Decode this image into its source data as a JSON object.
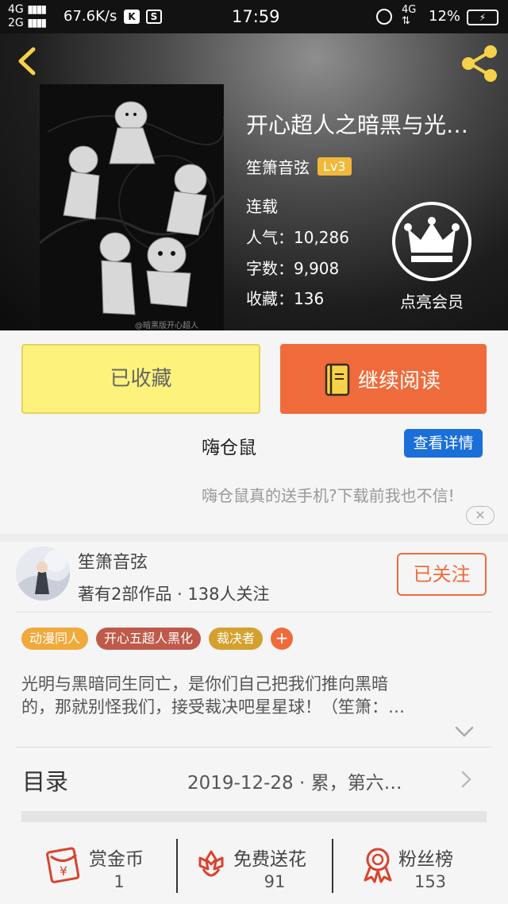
{
  "status_bar": {
    "network_primary": "4G",
    "network_secondary": "2G",
    "speed": "67.6K/s",
    "icon_k": "K",
    "icon_s": "S",
    "time": "17:59",
    "mobile_network": "4G",
    "battery_percent": "12%"
  },
  "header": {
    "book_title": "开心超人之暗黑与光…",
    "author": "笙箫音弦",
    "level_badge": "Lv3",
    "status": "连载",
    "popularity_label": "人气：",
    "popularity": "10,286",
    "word_count_label": "字数：",
    "word_count": "9,908",
    "favorites_label": "收藏：",
    "favorites": "136",
    "vip_label": "点亮会员",
    "cover_watermark": "@暗黑版开心超人"
  },
  "actions": {
    "collected_label": "已收藏",
    "continue_reading_label": "继续阅读"
  },
  "ad": {
    "title": "嗨仓鼠",
    "detail_button": "查看详情",
    "description": "嗨仓鼠真的送手机?下载前我也不信!",
    "close_symbol": "✕"
  },
  "author_card": {
    "name": "笙箫音弦",
    "stats": "著有2部作品 · 138人关注",
    "follow_label": "已关注"
  },
  "tags": [
    {
      "label": "动漫同人",
      "color": "#f0a93b"
    },
    {
      "label": "开心五超人黑化",
      "color": "#bf5a4a"
    },
    {
      "label": "裁决者",
      "color": "#d4a02e"
    }
  ],
  "tag_add_symbol": "+",
  "synopsis": {
    "line1": "光明与黑暗同生同亡，是你们自己把我们推向黑暗",
    "line2": "的，那就别怪我们，接受裁决吧星星球！（笙箫：…"
  },
  "catalog": {
    "label": "目录",
    "latest": "2019-12-28 · 累，第六…"
  },
  "bottom_stats": [
    {
      "label": "赏金币",
      "count": "1"
    },
    {
      "label": "免费送花",
      "count": "91"
    },
    {
      "label": "粉丝榜",
      "count": "153"
    }
  ],
  "colors": {
    "accent": "#ef6b3b",
    "collected_bg": "#fdf27c",
    "link_blue": "#1b6fd9",
    "level_badge": "#f0b93a",
    "icon_yellow": "#f5d24a"
  }
}
